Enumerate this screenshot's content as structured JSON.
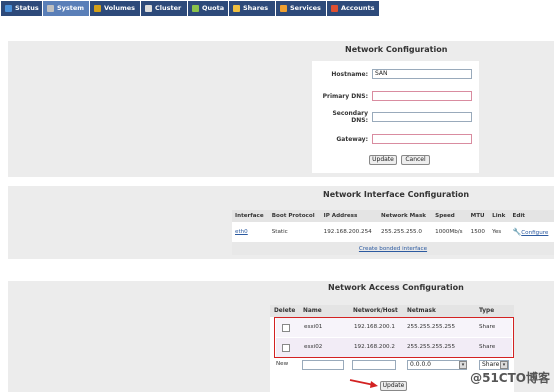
{
  "tabs": [
    {
      "label": "Status",
      "color": "#4a90d9"
    },
    {
      "label": "System",
      "color": "#c0c0c0"
    },
    {
      "label": "Volumes",
      "color": "#d4a017"
    },
    {
      "label": "Cluster",
      "color": "#dddddd"
    },
    {
      "label": "Quota",
      "color": "#8bc34a"
    },
    {
      "label": "Shares",
      "color": "#f0c040"
    },
    {
      "label": "Services",
      "color": "#f0a030"
    },
    {
      "label": "Accounts",
      "color": "#e05030"
    }
  ],
  "network_config": {
    "title": "Network Configuration",
    "hostname_label": "Hostname:",
    "hostname_value": "SAN",
    "primary_dns_label": "Primary DNS:",
    "primary_dns_value": "",
    "secondary_dns_label_1": "Secondary",
    "secondary_dns_label_2": "DNS:",
    "secondary_dns_value": "",
    "gateway_label": "Gateway:",
    "gateway_value": "",
    "update_label": "Update",
    "cancel_label": "Cancel"
  },
  "interface_config": {
    "title": "Network Interface Configuration",
    "headers": [
      "Interface",
      "Boot Protocol",
      "IP Address",
      "Network Mask",
      "Speed",
      "MTU",
      "Link",
      "Edit"
    ],
    "row": {
      "interface": "eth0",
      "boot": "Static",
      "ip": "192.168.200.254",
      "mask": "255.255.255.0",
      "speed": "1000Mb/s",
      "mtu": "1500",
      "link": "Yes",
      "edit": "Configure"
    },
    "bonded_link": "Create bonded interface"
  },
  "access_config": {
    "title": "Network Access Configuration",
    "headers": [
      "Delete",
      "Name",
      "Network/Host",
      "Netmask",
      "Type"
    ],
    "rows": [
      {
        "name": "esxi01",
        "host": "192.168.200.1",
        "mask": "255.255.255.255",
        "type": "Share"
      },
      {
        "name": "esxi02",
        "host": "192.168.200.2",
        "mask": "255.255.255.255",
        "type": "Share"
      }
    ],
    "new_label": "New",
    "new_mask": "0.0.0.0",
    "new_type": "Share",
    "update_label": "Update"
  },
  "watermark": "@51CTO博客"
}
